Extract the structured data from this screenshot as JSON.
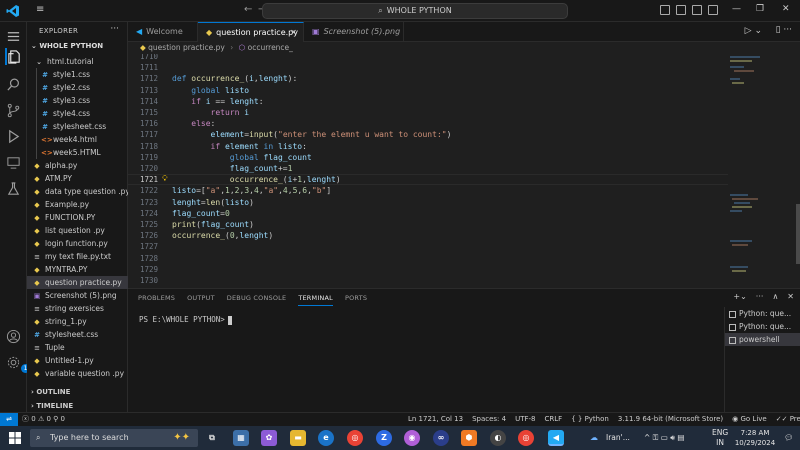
{
  "titlebar": {
    "search_text": "WHOLE PYTHON",
    "colors": {
      "accent": "#0078d4",
      "vscode_blue": "#23a9f2"
    }
  },
  "sidebar": {
    "header": "EXPLORER",
    "more": "···",
    "workspace": "WHOLE PYTHON",
    "items": [
      {
        "label": "html.tutorial",
        "icon": "folder-open-icon",
        "glyph": "⌄",
        "cls": "ic-folder",
        "level": 1
      },
      {
        "label": "style1.css",
        "icon": "css-file-icon",
        "glyph": "#",
        "cls": "ic-css",
        "level": 2
      },
      {
        "label": "style2.css",
        "icon": "css-file-icon",
        "glyph": "#",
        "cls": "ic-css",
        "level": 2
      },
      {
        "label": "style3.css",
        "icon": "css-file-icon",
        "glyph": "#",
        "cls": "ic-css",
        "level": 2
      },
      {
        "label": "style4.css",
        "icon": "css-file-icon",
        "glyph": "#",
        "cls": "ic-css",
        "level": 2
      },
      {
        "label": "stylesheet.css",
        "icon": "css-file-icon",
        "glyph": "#",
        "cls": "ic-css",
        "level": 2
      },
      {
        "label": "week4.html",
        "icon": "html-file-icon",
        "glyph": "<>",
        "cls": "ic-html",
        "level": 2
      },
      {
        "label": "week5.HTML",
        "icon": "html-file-icon",
        "glyph": "<>",
        "cls": "ic-html",
        "level": 2
      },
      {
        "label": "alpha.py",
        "icon": "python-file-icon",
        "glyph": "◆",
        "cls": "ic-py",
        "level": 0
      },
      {
        "label": "ATM.PY",
        "icon": "python-file-icon",
        "glyph": "◆",
        "cls": "ic-py",
        "level": 0
      },
      {
        "label": "data type question .py",
        "icon": "python-file-icon",
        "glyph": "◆",
        "cls": "ic-py",
        "level": 0
      },
      {
        "label": "Example.py",
        "icon": "python-file-icon",
        "glyph": "◆",
        "cls": "ic-py",
        "level": 0
      },
      {
        "label": "FUNCTION.PY",
        "icon": "python-file-icon",
        "glyph": "◆",
        "cls": "ic-py",
        "level": 0
      },
      {
        "label": "list question .py",
        "icon": "python-file-icon",
        "glyph": "◆",
        "cls": "ic-py",
        "level": 0
      },
      {
        "label": "login function.py",
        "icon": "python-file-icon",
        "glyph": "◆",
        "cls": "ic-py",
        "level": 0
      },
      {
        "label": "my text file.py.txt",
        "icon": "text-file-icon",
        "glyph": "≡",
        "cls": "ic-txt",
        "level": 0
      },
      {
        "label": "MYNTRA.PY",
        "icon": "python-file-icon",
        "glyph": "◆",
        "cls": "ic-py",
        "level": 0
      },
      {
        "label": "question practice.py",
        "icon": "python-file-icon",
        "glyph": "◆",
        "cls": "ic-py",
        "level": 0,
        "active": true
      },
      {
        "label": "Screenshot (5).png",
        "icon": "image-file-icon",
        "glyph": "▣",
        "cls": "ic-png",
        "level": 0
      },
      {
        "label": "string exersices",
        "icon": "text-file-icon",
        "glyph": "≡",
        "cls": "ic-txt",
        "level": 0
      },
      {
        "label": "string_1.py",
        "icon": "python-file-icon",
        "glyph": "◆",
        "cls": "ic-py",
        "level": 0
      },
      {
        "label": "stylesheet.css",
        "icon": "css-file-icon",
        "glyph": "#",
        "cls": "ic-css",
        "level": 0
      },
      {
        "label": "Tuple",
        "icon": "text-file-icon",
        "glyph": "≡",
        "cls": "ic-txt",
        "level": 0
      },
      {
        "label": "Untitled-1.py",
        "icon": "python-file-icon",
        "glyph": "◆",
        "cls": "ic-py",
        "level": 0
      },
      {
        "label": "variable question .py",
        "icon": "python-file-icon",
        "glyph": "◆",
        "cls": "ic-py",
        "level": 0
      }
    ],
    "outline": "OUTLINE",
    "timeline": "TIMELINE"
  },
  "tabs": [
    {
      "label": "Welcome",
      "icon": "vscode-icon",
      "glyph": "◀",
      "color": "#23a9f2",
      "active": false,
      "italic": false
    },
    {
      "label": "question practice.py",
      "icon": "python-file-icon",
      "glyph": "◆",
      "color": "#e8c84e",
      "active": true,
      "italic": false
    },
    {
      "label": "Screenshot (5).png",
      "icon": "image-file-icon",
      "glyph": "▣",
      "color": "#a07ad6",
      "active": false,
      "italic": true
    }
  ],
  "breadcrumb": {
    "file": "question practice.py",
    "symbol": "occurrence_"
  },
  "editor": {
    "current_line": "1721",
    "lines": [
      {
        "n": "1710",
        "html": ""
      },
      {
        "n": "1711",
        "html": ""
      },
      {
        "n": "1712",
        "html": "<span class='kw'>def</span> <span class='fn'>occurrence_</span>(<span class='vr'>i</span>,<span class='vr'>lenght</span>):"
      },
      {
        "n": "1713",
        "html": "    <span class='kw'>global</span> <span class='vr'>listo</span>"
      },
      {
        "n": "1714",
        "html": "    <span class='kw2'>if</span> <span class='vr'>i</span> == <span class='vr'>lenght</span>:"
      },
      {
        "n": "1715",
        "html": "        <span class='kw2'>return</span> <span class='vr'>i</span>"
      },
      {
        "n": "1716",
        "html": "    <span class='kw2'>else</span>:"
      },
      {
        "n": "1717",
        "html": "        <span class='vr'>element</span>=<span class='fn'>input</span>(<span class='str'>\"enter the elemnt u want to count:\"</span>)"
      },
      {
        "n": "1718",
        "html": "        <span class='kw2'>if</span> <span class='vr'>element</span> <span class='kw'>in</span> <span class='vr'>listo</span>:"
      },
      {
        "n": "1719",
        "html": "            <span class='kw'>global</span> <span class='vr'>flag_count</span>"
      },
      {
        "n": "1720",
        "html": "            <span class='vr'>flag_count</span>+=<span class='num'>1</span>"
      },
      {
        "n": "1721",
        "html": "            <span class='fn'>occurrence_</span>(<span class='vr'>i</span>+<span class='num'>1</span>,<span class='vr'>lenght</span>)"
      },
      {
        "n": "1722",
        "html": "<span class='vr'>listo</span>=[<span class='str'>\"a\"</span>,<span class='num'>1</span>,<span class='num'>2</span>,<span class='num'>3</span>,<span class='num'>4</span>,<span class='str'>\"a\"</span>,<span class='num'>4</span>,<span class='num'>5</span>,<span class='num'>6</span>,<span class='str'>\"b\"</span>]"
      },
      {
        "n": "1723",
        "html": "<span class='vr'>lenght</span>=<span class='fn'>len</span>(<span class='vr'>listo</span>)"
      },
      {
        "n": "1724",
        "html": "<span class='vr'>flag_count</span>=<span class='num'>0</span>"
      },
      {
        "n": "1725",
        "html": "<span class='fn'>print</span>(<span class='vr'>flag_count</span>)"
      },
      {
        "n": "1726",
        "html": "<span class='fn'>occurrence_</span>(<span class='num'>0</span>,<span class='vr'>lenght</span>)"
      },
      {
        "n": "1727",
        "html": ""
      },
      {
        "n": "1728",
        "html": ""
      },
      {
        "n": "1729",
        "html": ""
      },
      {
        "n": "1730",
        "html": ""
      }
    ]
  },
  "panel": {
    "tabs": [
      "PROBLEMS",
      "OUTPUT",
      "DEBUG CONSOLE",
      "TERMINAL",
      "PORTS"
    ],
    "active_tab": "TERMINAL",
    "prompt": "PS E:\\WHOLE PYTHON>",
    "terminals": [
      {
        "label": "Python: que...",
        "active": false
      },
      {
        "label": "Python: que...",
        "active": false
      },
      {
        "label": "powershell",
        "active": true
      }
    ]
  },
  "statusbar": {
    "errors": "0",
    "warnings": "0",
    "ports": "0",
    "position": "Ln 1721, Col 13",
    "spaces": "Spaces: 4",
    "encoding": "UTF-8",
    "eol": "CRLF",
    "language": "Python",
    "interpreter": "3.11.9 64-bit (Microsoft Store)",
    "golive": "Go Live",
    "prettier": "Prettier"
  },
  "taskbar": {
    "search_placeholder": "Type here to search",
    "weather": "Iran'...",
    "lang_top": "ENG",
    "lang_bottom": "IN",
    "time": "7:28 AM",
    "date": "10/29/2024"
  }
}
